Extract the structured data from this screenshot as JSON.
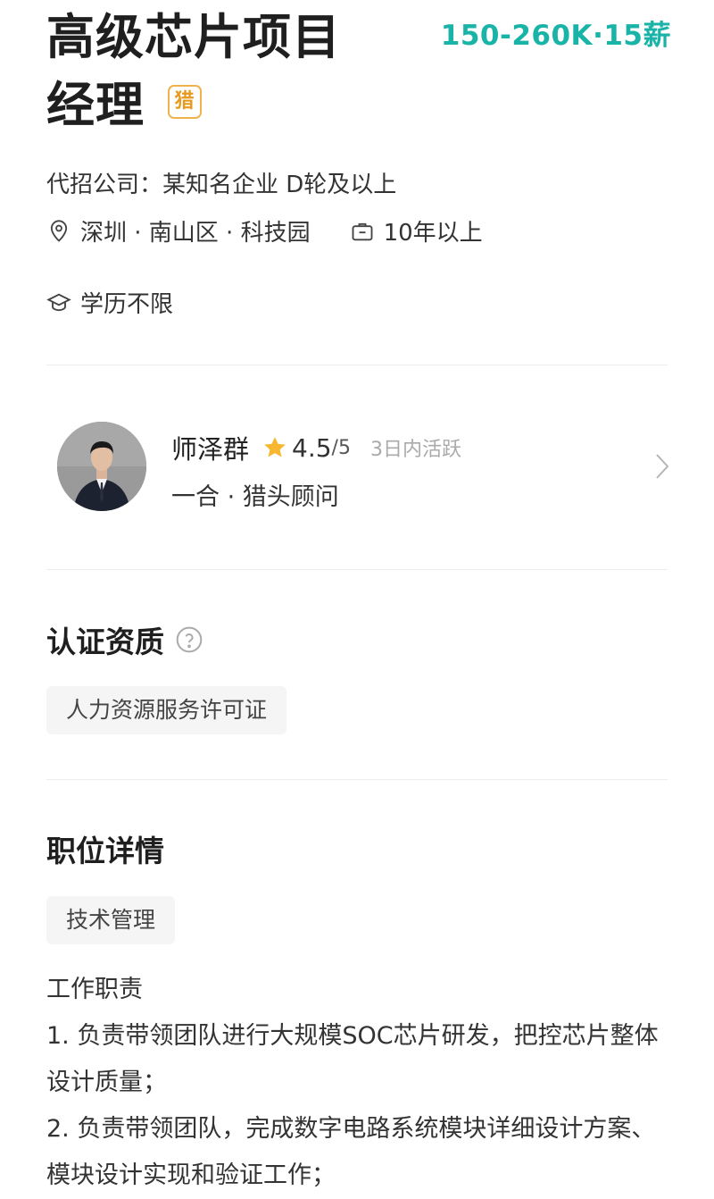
{
  "job": {
    "title_line1": "高级芯片项目",
    "title_line2": "经理",
    "hunter_badge": "猎",
    "salary": "150-260K·15薪"
  },
  "company_line": "代招公司：某知名企业   D轮及以上",
  "location": "深圳 · 南山区 · 科技园",
  "experience": "10年以上",
  "education": "学历不限",
  "recruiter": {
    "name": "师泽群",
    "rating": "4.5",
    "rating_total": "/5",
    "activity": "3日内活跃",
    "subtitle": "一合  ·  猎头顾问"
  },
  "certification": {
    "title": "认证资质",
    "tag": "人力资源服务许可证"
  },
  "job_detail": {
    "title": "职位详情",
    "tag": "技术管理",
    "lines": [
      "工作职责",
      "1. 负责带领团队进行大规模SOC芯片研发，把控芯片整体设计质量；",
      "2. 负责带领团队，完成数字电路系统模块详细设计方案、模块设计实现和验证工作；"
    ]
  },
  "colors": {
    "salary": "#19b3a8",
    "badge": "#f0b34b",
    "star": "#f7b731"
  },
  "icons": [
    "location-icon",
    "briefcase-icon",
    "graduation-cap-icon",
    "star-icon",
    "help-icon",
    "chevron-right-icon"
  ]
}
